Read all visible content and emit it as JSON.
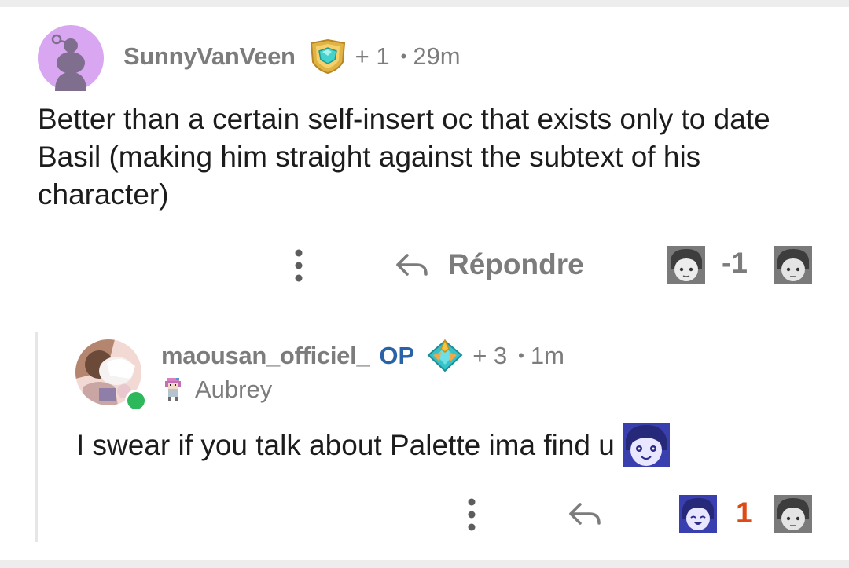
{
  "comment1": {
    "username": "SunnyVanVeen",
    "score": "+ 1",
    "separator": "•",
    "time": "29m",
    "body": "Better than a certain self-insert oc that exists only to date Basil (making him straight against the subtext of his character)",
    "actions": {
      "reply_label": "Répondre",
      "vote_count": "-1"
    }
  },
  "comment2": {
    "username": "maousan_officiel_",
    "op_badge": "OP",
    "score": "+ 3",
    "separator": "•",
    "time": "1m",
    "user_flair": "Aubrey",
    "body": "I swear if you talk about Palette ima find u",
    "actions": {
      "vote_count": "1"
    }
  },
  "colors": {
    "meta_gray": "#7c7c7c",
    "op_blue": "#2962a8",
    "upvoted_orange": "#dd4a16",
    "online_green": "#2eb85c",
    "avatar_purple": "#d9a6f2"
  },
  "icons": [
    "snoo-avatar-icon",
    "achievement-flair-icon",
    "more-options-icon",
    "reply-arrow-icon",
    "upvote-face-icon",
    "downvote-face-icon",
    "online-status-icon",
    "aubrey-sprite-icon",
    "omori-emote-icon"
  ]
}
